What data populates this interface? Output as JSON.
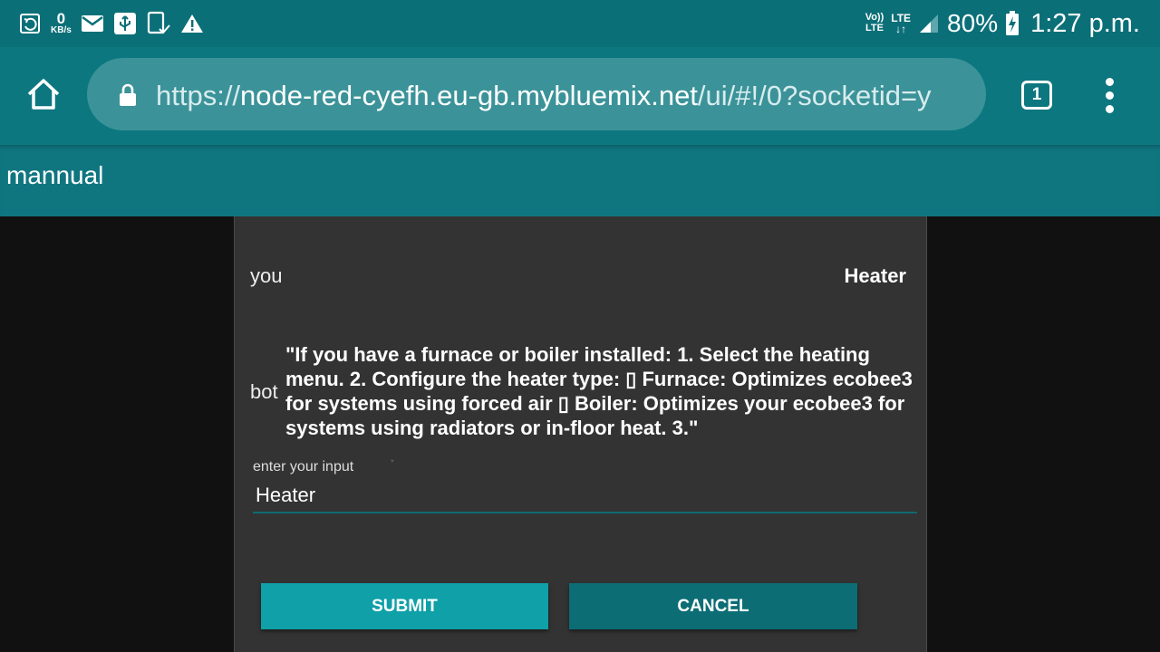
{
  "status_bar": {
    "net_speed_value": "0",
    "net_speed_unit": "KB/s",
    "volte_line1": "Vo))",
    "volte_line2": "LTE",
    "lte_line1": "LTE",
    "lte_line2": "↓↑",
    "battery_percent": "80%",
    "time": "1:27 p.m.",
    "icons": [
      "recent-data-icon",
      "mail-icon",
      "usb-icon",
      "screenshot-icon",
      "warning-icon",
      "signal-icon",
      "battery-charging-icon"
    ]
  },
  "browser": {
    "url_scheme": "https://",
    "url_host": "node-red-cyefh.eu-gb.mybluemix.net",
    "url_path": "/ui/#!/0?socketid=y",
    "tab_count": "1",
    "icons": [
      "home-icon",
      "lock-icon",
      "overflow-menu-icon"
    ]
  },
  "header": {
    "title": "mannual"
  },
  "chat": {
    "user_label": "you",
    "user_message": "Heater",
    "bot_label": "bot",
    "bot_message": "\"If you have a furnace or boiler installed: 1. Select the heating menu. 2. Configure the heater type: ▯ Furnace: Optimizes ecobee3 for systems using forced air ▯ Boiler: Optimizes your ecobee3 for systems using radiators or in-floor heat. 3.\""
  },
  "form": {
    "input_label": "enter your input",
    "input_value": "Heater",
    "submit_label": "SUBMIT",
    "cancel_label": "CANCEL"
  },
  "colors": {
    "status_bar": "#0b6f78",
    "toolbar": "#0d7780",
    "submit": "#0fa0a8",
    "cancel": "#0c6d75",
    "card": "#333333"
  }
}
